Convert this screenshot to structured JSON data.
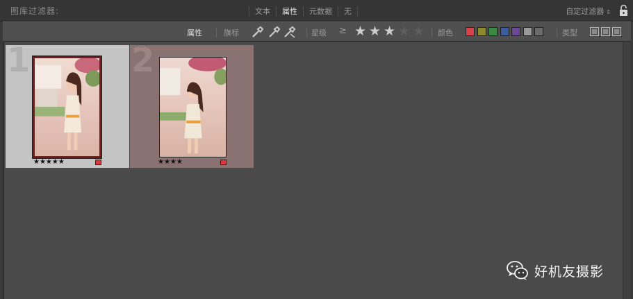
{
  "filter_bar": {
    "title": "图库过滤器:",
    "tabs": [
      {
        "label": "文本",
        "active": false
      },
      {
        "label": "属性",
        "active": true
      },
      {
        "label": "元数据",
        "active": false
      },
      {
        "label": "无",
        "active": false
      }
    ],
    "preset_label": "自定过滤器",
    "preset_arrows": "⇕",
    "lock_icon": "lock-open-icon"
  },
  "attribute_bar": {
    "attribute_label": "属性",
    "flag_label": "旗标",
    "rating_label": "星级",
    "rating_operator": "≥",
    "rating_value": 3,
    "rating_max": 5,
    "color_label": "颜色",
    "color_swatches": [
      "#d8424a",
      "#8b8a2e",
      "#3a8a44",
      "#3d5e9e",
      "#6a4a98",
      "#9a9a9a",
      "#6b6b6b"
    ],
    "type_label": "类型"
  },
  "grid": {
    "cells": [
      {
        "index": "1",
        "rating_stars": "★★★★★",
        "rating": 5,
        "color_label": "#d63a3e",
        "selected": true
      },
      {
        "index": "2",
        "rating_stars": "★★★★",
        "rating": 4,
        "color_label": "#d63a3e",
        "selected": false
      }
    ]
  },
  "watermark": {
    "text": "好机友摄影",
    "icon": "wechat-icon"
  }
}
